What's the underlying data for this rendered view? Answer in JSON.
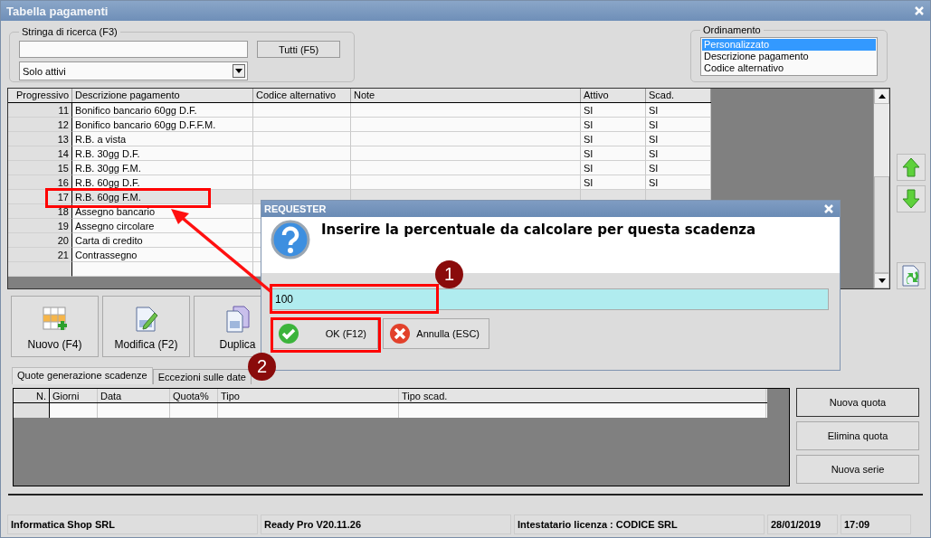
{
  "window": {
    "title": "Tabella pagamenti"
  },
  "search": {
    "legend": "Stringa di ricerca (F3)",
    "all_button": "Tutti (F5)",
    "filter": "Solo attivi"
  },
  "ordering": {
    "legend": "Ordinamento",
    "items": [
      {
        "label": "Personalizzato",
        "selected": true
      },
      {
        "label": "Descrizione pagamento",
        "selected": false
      },
      {
        "label": "Codice alternativo",
        "selected": false
      }
    ]
  },
  "table": {
    "columns": [
      "Progressivo",
      "Descrizione pagamento",
      "Codice alternativo",
      "Note",
      "Attivo",
      "Scad."
    ],
    "rows": [
      {
        "progressivo": "11",
        "descrizione": "Bonifico bancario 60gg D.F.",
        "attivo": "SI",
        "scad": "SI",
        "selected": false
      },
      {
        "progressivo": "12",
        "descrizione": "Bonifico bancario 60gg D.F.F.M.",
        "attivo": "SI",
        "scad": "SI",
        "selected": false
      },
      {
        "progressivo": "13",
        "descrizione": "R.B. a vista",
        "attivo": "SI",
        "scad": "SI",
        "selected": false
      },
      {
        "progressivo": "14",
        "descrizione": "R.B. 30gg D.F.",
        "attivo": "SI",
        "scad": "SI",
        "selected": false
      },
      {
        "progressivo": "15",
        "descrizione": "R.B. 30gg F.M.",
        "attivo": "SI",
        "scad": "SI",
        "selected": false
      },
      {
        "progressivo": "16",
        "descrizione": "R.B. 60gg D.F.",
        "attivo": "SI",
        "scad": "SI",
        "selected": false
      },
      {
        "progressivo": "17",
        "descrizione": "R.B. 60gg F.M.",
        "selected": true
      },
      {
        "progressivo": "18",
        "descrizione": "Assegno bancario",
        "selected": false
      },
      {
        "progressivo": "19",
        "descrizione": "Assegno circolare",
        "selected": false
      },
      {
        "progressivo": "20",
        "descrizione": "Carta di credito",
        "selected": false
      },
      {
        "progressivo": "21",
        "descrizione": "Contrassegno",
        "selected": false
      }
    ]
  },
  "toolbar": [
    {
      "kind": "new",
      "label": "Nuovo (F4)"
    },
    {
      "kind": "edit",
      "label": "Modifica (F2)"
    },
    {
      "kind": "copy",
      "label": "Duplica"
    }
  ],
  "tabs": [
    {
      "label": "Quote generazione scadenze",
      "selected": true
    },
    {
      "label": "Eccezioni sulle date",
      "selected": false
    }
  ],
  "quote_table": {
    "columns": [
      "N.",
      "Giorni",
      "Data",
      "Quota%",
      "Tipo",
      "Tipo scad."
    ]
  },
  "quote_buttons": [
    "Nuova quota",
    "Elimina quota",
    "Nuova serie"
  ],
  "status_bar": [
    "Informatica Shop SRL",
    "Ready Pro V20.11.26",
    "Intestatario licenza : CODICE SRL",
    "28/01/2019",
    "17:09"
  ],
  "dialog": {
    "title": "REQUESTER",
    "message": "Inserire la percentuale da calcolare per questa scadenza",
    "value": "100",
    "buttons": [
      {
        "kind": "ok",
        "label": "OK (F12)"
      },
      {
        "kind": "cancel",
        "label": "Annulla (ESC)"
      }
    ]
  },
  "callouts": [
    "1",
    "2"
  ]
}
